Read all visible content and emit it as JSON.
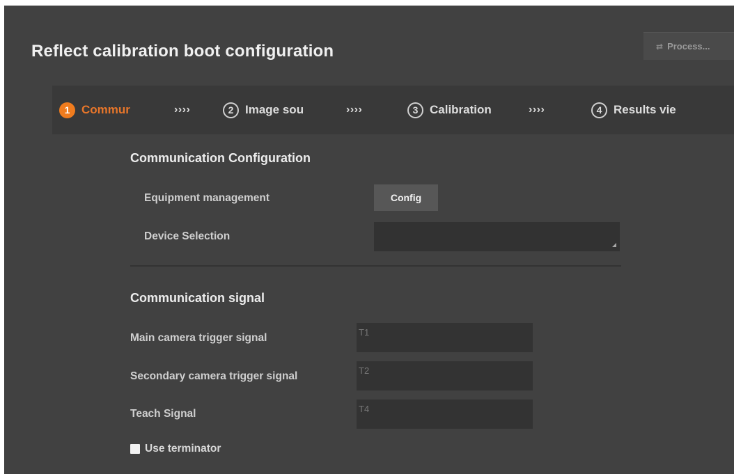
{
  "header": {
    "title": "Reflect calibration boot configuration",
    "process_button": "Process..."
  },
  "steps": [
    {
      "number": "1",
      "label": "Commur",
      "active": true
    },
    {
      "number": "2",
      "label": "Image sou",
      "active": false
    },
    {
      "number": "3",
      "label": "Calibration",
      "active": false
    },
    {
      "number": "4",
      "label": "Results vie",
      "active": false
    }
  ],
  "step_separator": "››››",
  "communication_config": {
    "heading": "Communication Configuration",
    "equipment_label": "Equipment management",
    "config_button": "Config",
    "device_label": "Device Selection",
    "device_value": ""
  },
  "communication_signal": {
    "heading": "Communication signal",
    "fields": [
      {
        "label": "Main camera trigger signal",
        "value": "T1"
      },
      {
        "label": "Secondary camera trigger signal",
        "value": "T2"
      },
      {
        "label": "Teach Signal",
        "value": "T4"
      }
    ],
    "use_terminator_label": "Use terminator",
    "use_terminator_checked": false
  },
  "colors": {
    "accent": "#f07c1e",
    "panel": "#414141",
    "stepbar": "#393939",
    "input": "#333333"
  }
}
